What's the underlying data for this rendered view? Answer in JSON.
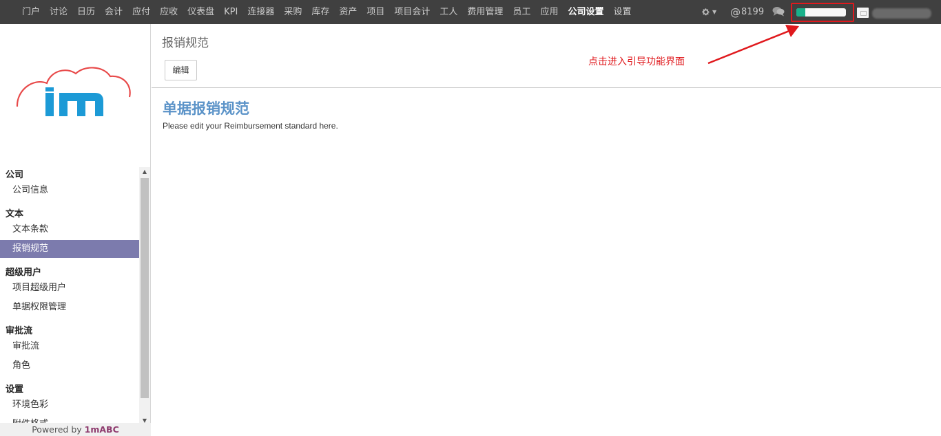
{
  "topnav": {
    "items": [
      "门户",
      "讨论",
      "日历",
      "会计",
      "应付",
      "应收",
      "仪表盘",
      "KPI",
      "连接器",
      "采购",
      "库存",
      "资产",
      "项目",
      "项目会计",
      "工人",
      "费用管理",
      "员工",
      "应用",
      "公司设置",
      "设置"
    ],
    "active": "公司设置"
  },
  "topright": {
    "mention_count": "8199",
    "guide_progress": 0.18,
    "icons": [
      "gear-icon",
      "chevron-down-icon",
      "at-icon",
      "chat-icon",
      "avatar"
    ]
  },
  "sidebar": {
    "sections": [
      {
        "title": "公司",
        "items": [
          "公司信息"
        ]
      },
      {
        "title": "文本",
        "items": [
          "文本条款",
          "报销规范"
        ]
      },
      {
        "title": "超级用户",
        "items": [
          "项目超级用户",
          "单据权限管理"
        ]
      },
      {
        "title": "审批流",
        "items": [
          "审批流",
          "角色"
        ]
      },
      {
        "title": "设置",
        "items": [
          "环境色彩",
          "附件格式"
        ]
      }
    ],
    "active_item": "报销规范",
    "footer_prefix": "Powered by",
    "footer_brand": "1mABC"
  },
  "main": {
    "breadcrumb": "报销规范",
    "edit_button": "编辑",
    "doc_title": "单据报销规范",
    "doc_body": "Please edit your Reimbursement standard here."
  },
  "annotation": {
    "text": "点击进入引导功能界面",
    "color": "#e0191d"
  },
  "colors": {
    "topbar": "#404040",
    "active_menu": "#7c7bad",
    "doc_title": "#5b93c8",
    "logo_red": "#e84a4a",
    "logo_blue": "#1c9ad6",
    "guide_fill": "#18b18a"
  }
}
